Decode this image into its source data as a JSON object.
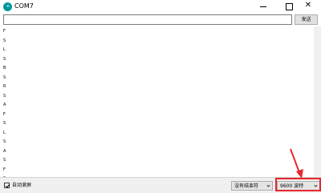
{
  "window": {
    "app_icon_text": "∞",
    "title": "COM7",
    "minimize_glyph": "",
    "maximize_glyph": "",
    "close_glyph": "✕"
  },
  "send_bar": {
    "input_value": "",
    "send_label": "发送"
  },
  "serial_output": {
    "lines": [
      "F",
      "S",
      "L",
      "S",
      "B",
      "S",
      "R",
      "S",
      "A",
      "F",
      "S",
      "L",
      "S",
      "A",
      "S",
      "F",
      "S",
      "A"
    ]
  },
  "bottom_bar": {
    "autoscroll_label": "自动滚屏",
    "autoscroll_checked": true,
    "line_ending_value": "没有结束符",
    "baud_value": "9600  波特"
  },
  "colors": {
    "annotation": "#e8262d",
    "arduino_teal": "#00979c"
  },
  "icons": {
    "app": "arduino-logo-icon",
    "dropdown": "chevron-down-icon",
    "annotation": "red-arrow-icon"
  }
}
